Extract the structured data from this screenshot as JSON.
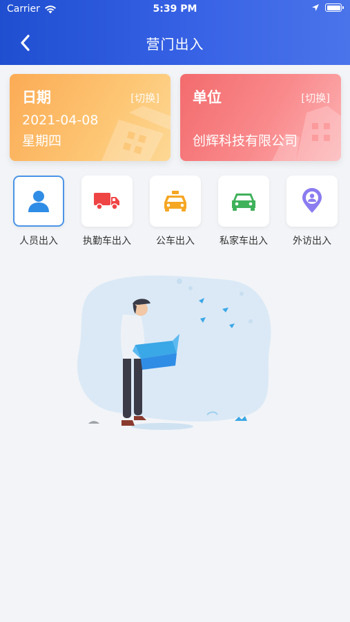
{
  "status_bar": {
    "carrier": "Carrier",
    "time": "5:39 PM"
  },
  "nav": {
    "title": "营门出入",
    "back_icon": "chevron-left-icon"
  },
  "cards": {
    "date": {
      "title": "日期",
      "switch_label": "[切换]",
      "date": "2021-04-08",
      "weekday": "星期四"
    },
    "unit": {
      "title": "单位",
      "switch_label": "[切换]",
      "company": "创辉科技有限公司"
    }
  },
  "menu": [
    {
      "label": "人员出入",
      "icon": "person-icon",
      "color": "#2f8de6",
      "selected": true
    },
    {
      "label": "执勤车出入",
      "icon": "truck-icon",
      "color": "#ef4444",
      "selected": false
    },
    {
      "label": "公车出入",
      "icon": "taxi-icon",
      "color": "#f5a623",
      "selected": false
    },
    {
      "label": "私家车出入",
      "icon": "car-icon",
      "color": "#3fb15a",
      "selected": false
    },
    {
      "label": "外访出入",
      "icon": "location-person-icon",
      "color": "#8b7cf0",
      "selected": false
    }
  ],
  "colors": {
    "header_start": "#1f4fd0",
    "header_end": "#4a74ea",
    "date_card": "#fcab55",
    "unit_card": "#f36b6d",
    "background": "#f2f4f7"
  }
}
